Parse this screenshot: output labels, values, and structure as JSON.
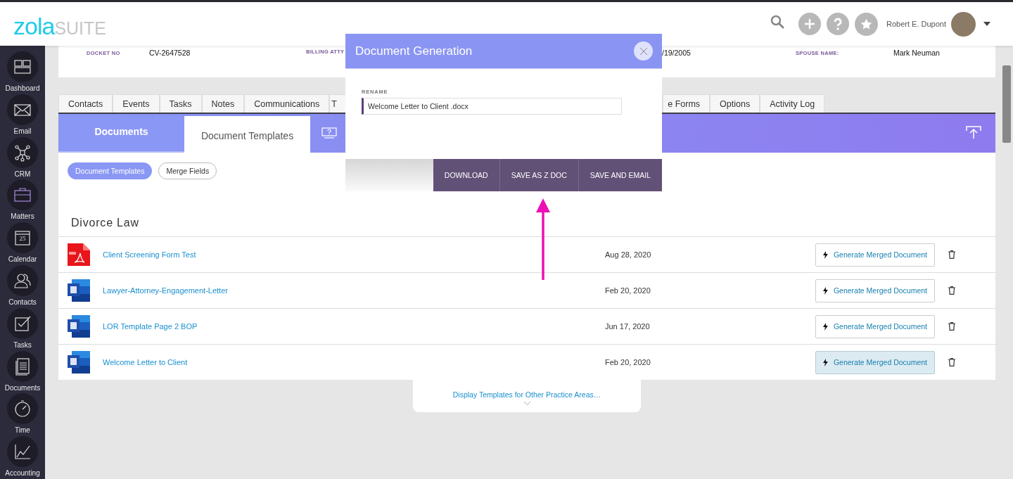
{
  "header": {
    "logo": {
      "primary": "zola",
      "secondary": "SUITE"
    },
    "user_name": "Robert E. Dupont"
  },
  "sidebar": {
    "items": [
      {
        "label": "Dashboard",
        "kind": "dashboard"
      },
      {
        "label": "Email",
        "kind": "email"
      },
      {
        "label": "CRM",
        "kind": "crm"
      },
      {
        "label": "Matters",
        "kind": "matters"
      },
      {
        "label": "Calendar",
        "kind": "calendar",
        "badge": "25"
      },
      {
        "label": "Contacts",
        "kind": "contacts"
      },
      {
        "label": "Tasks",
        "kind": "tasks"
      },
      {
        "label": "Documents",
        "kind": "documents"
      },
      {
        "label": "Time",
        "kind": "time"
      },
      {
        "label": "Accounting",
        "kind": "accounting"
      }
    ]
  },
  "matter_info": [
    {
      "label": "DOCKET NO",
      "value": "CV-2647528"
    },
    {
      "label": "BILLING ATTY"
    },
    {
      "value": "/19/2005"
    },
    {
      "label": "SPOUSE NAME:",
      "value": "Mark Neuman"
    }
  ],
  "tabs": [
    {
      "label": "Contacts",
      "selected": false
    },
    {
      "label": "Events",
      "selected": false
    },
    {
      "label": "Tasks",
      "selected": false
    },
    {
      "label": "Notes",
      "selected": false
    },
    {
      "label": "Communications",
      "selected": false
    },
    {
      "label": "T",
      "selected": false
    },
    {
      "label": "e Forms",
      "selected": false
    },
    {
      "label": "Options",
      "selected": false
    },
    {
      "label": "Activity Log",
      "selected": false
    }
  ],
  "subtabs": [
    {
      "label": "Documents",
      "selected": false
    },
    {
      "label": "Document Templates",
      "selected": true
    }
  ],
  "filters": [
    {
      "label": "Document Templates",
      "selected": true
    },
    {
      "label": "Merge Fields",
      "selected": false
    }
  ],
  "section_title": "Divorce Law",
  "templates": [
    {
      "kind": "pdf",
      "name": "Client Screening Form Test",
      "date": "Aug 28, 2020",
      "action": "Generate Merged Document",
      "highlighted": false
    },
    {
      "kind": "word",
      "name": "Lawyer-Attorney-Engagement-Letter",
      "date": "Feb 20, 2020",
      "action": "Generate Merged Document",
      "highlighted": false
    },
    {
      "kind": "word",
      "name": "LOR Template Page 2 BOP",
      "date": "Jun 17, 2020",
      "action": "Generate Merged Document",
      "highlighted": false
    },
    {
      "kind": "word",
      "name": "Welcome Letter to Client",
      "date": "Feb 20, 2020",
      "action": "Generate Merged Document",
      "highlighted": true
    }
  ],
  "more_link": "Display Templates for Other Practice Areas…",
  "modal": {
    "title": "Document Generation",
    "field_label": "RENAME",
    "field_value": "Welcome Letter to Client .docx",
    "buttons": [
      "DOWNLOAD",
      "SAVE AS Z DOC",
      "SAVE AND EMAIL"
    ]
  }
}
